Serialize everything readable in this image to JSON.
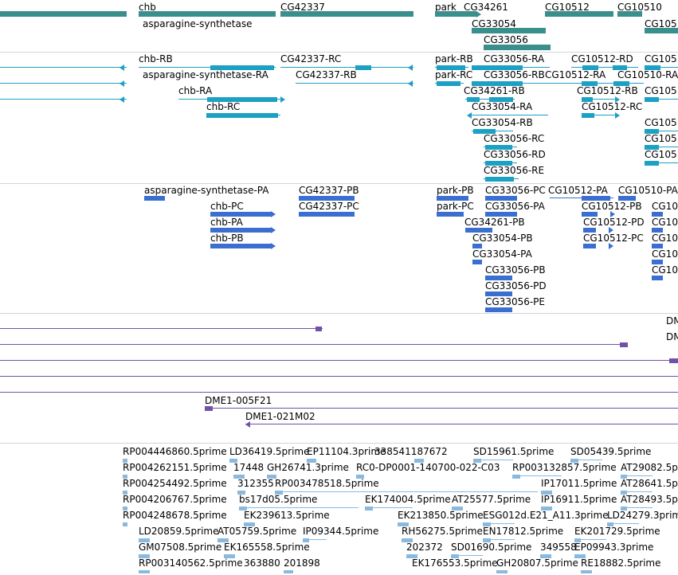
{
  "colors": {
    "gene": "#3a8f8c",
    "transcript": "#1ca0c4",
    "protein": "#3a6fd1",
    "clone": "#7053a8",
    "est": "#8ab9e0",
    "separator": "#cfd6dc"
  },
  "tracks": {
    "genes": {
      "labels": [
        "chb",
        "asparagine-synthetase",
        "CG42337",
        "park",
        "CG34261",
        "CG33054",
        "CG10512",
        "CG10510",
        "CG33056",
        "CG105"
      ]
    },
    "transcripts": {
      "labels": [
        "chb-RB",
        "asparagine-synthetase-RA",
        "chb-RA",
        "chb-RC",
        "CG42337-RC",
        "CG42337-RB",
        "park-RB",
        "park-RC",
        "CG33056-RA",
        "CG33056-RB",
        "CG10512-RA",
        "CG10512-RD",
        "CG10510-RA",
        "CG34261-RB",
        "CG10512-RB",
        "CG33054-RA",
        "CG10512-RC",
        "CG33054-RB",
        "CG33056-RC",
        "CG33056-RD",
        "CG33056-RE",
        "CG105",
        "CG105",
        "CG105",
        "CG105",
        "CG105"
      ]
    },
    "proteins": {
      "labels": [
        "asparagine-synthetase-PA",
        "chb-PC",
        "chb-PA",
        "chb-PB",
        "CG42337-PB",
        "CG42337-PC",
        "park-PB",
        "park-PC",
        "CG33056-PC",
        "CG10512-PA",
        "CG10510-PA",
        "CG33056-PA",
        "CG10512-PB",
        "CG34261-PB",
        "CG10512-PD",
        "CG33054-PB",
        "CG10512-PC",
        "CG33054-PA",
        "CG33056-PB",
        "CG33056-PD",
        "CG33056-PE",
        "CG10",
        "CG10",
        "CG10",
        "CG10",
        "CG10"
      ]
    },
    "clones": {
      "labels": [
        "DME1-005F21",
        "DME1-021M02",
        "DM",
        "DM"
      ]
    },
    "ests": {
      "labels": [
        "RP004446860.5prime",
        "LD36419.5prime",
        "EP11104.3prime",
        "338541187672",
        "SD15961.5prime",
        "SD05439.5prime",
        "RP004262151.5prime",
        "17448",
        "GH26741.3prime",
        "RC0-DP0001-140700-022-C03",
        "RP003132857.5prime",
        "AT29082.5p",
        "RP004254492.5prime",
        "312355",
        "RP003478518.5prime",
        "IP17011.5prime",
        "AT28641.5p",
        "RP004206767.5prime",
        "bs17d05.5prime",
        "EK174004.5prime",
        "AT25577.5prime",
        "IP16911.5prime",
        "AT28493.5p",
        "RP004248678.5prime",
        "EK239613.5prime",
        "EK213850.5prime",
        "ESG012d.E21_A11.3prime",
        "LD24279.3prim",
        "LD20859.5prime",
        "AT05759.5prime",
        "IP09344.5prime",
        "RH56275.5prime",
        "EN17812.5prime",
        "EK201729.5prime",
        "GM07508.5prime",
        "EK165558.5prime",
        "202372",
        "SD01690.5prime",
        "349558",
        "EP09943.3prime",
        "RP003140562.5prime",
        "363880",
        "201898",
        "EK176553.5prime",
        "GH20807.5prime",
        "RE18882.5prime"
      ]
    }
  }
}
